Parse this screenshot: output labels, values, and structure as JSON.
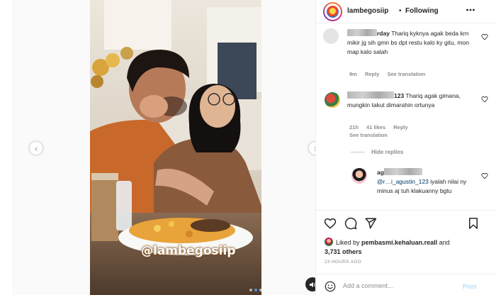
{
  "post": {
    "username": "lambegosiip",
    "separator": "•",
    "follow_status": "Following",
    "more_icon": "more-horizontal-icon",
    "watermark": "@lambegosiip",
    "carousel": {
      "slide_count": 3,
      "active_index": 1
    },
    "nav_prev_glyph": "‹",
    "nav_next_glyph": "›"
  },
  "comments": [
    {
      "username_visible": "rday",
      "text": "Thariq kyknya agak beda krn mikir jg sih gmn bs dpt restu kalo ky gitu, mon map kalo salah",
      "time": "9m",
      "reply_label": "Reply",
      "translation_label": "See translation"
    },
    {
      "username_visible": "123",
      "text": "Thariq agak gimana, mungkin takut dimarahin ortunya",
      "time": "21h",
      "likes": "41 likes",
      "reply_label": "Reply",
      "translation_label": "See translation",
      "hide_replies_label": "Hide replies",
      "replies": [
        {
          "username_visible": "ag",
          "mention": "@r…i_agustin_123",
          "text": "iyalah nilai ny minus aj tuh klakuanny bgtu"
        }
      ]
    }
  ],
  "likes": {
    "prefix": "Liked by",
    "liker": "pembasmi.kehaluan.reall",
    "conjunction": "and",
    "others": "3,731 others"
  },
  "timestamp": "23 HOURS AGO",
  "add_comment": {
    "placeholder": "Add a comment...",
    "post_label": "Post"
  },
  "colors": {
    "link": "#00376b",
    "muted": "#8e8e8e",
    "post_disabled": "#b2dffc",
    "border": "#efefef"
  }
}
